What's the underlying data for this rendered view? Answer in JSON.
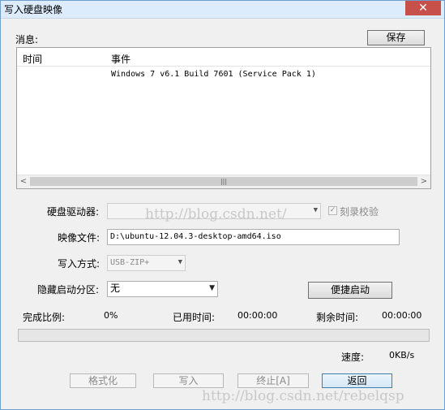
{
  "window": {
    "title": "写入硬盘映像",
    "close_glyph": "✕"
  },
  "messages": {
    "label": "消息:",
    "save_label": "保存",
    "columns": {
      "time": "时间",
      "event": "事件"
    },
    "rows": [
      {
        "time": "",
        "event": "Windows 7 v6.1 Build 7601 (Service Pack 1)"
      }
    ],
    "scroll_left": "<",
    "scroll_right": ">",
    "thumb_grip": "|||"
  },
  "form": {
    "disk_drive_label": "硬盘驱动器:",
    "disk_drive_value": "",
    "verify_label": "刻录校验",
    "verify_checked": true,
    "image_file_label": "映像文件:",
    "image_file_value": "D:\\ubuntu-12.04.3-desktop-amd64.iso",
    "write_method_label": "写入方式:",
    "write_method_value": "USB-ZIP+",
    "hidden_partition_label": "隐藏启动分区:",
    "hidden_partition_value": "无",
    "quick_boot_label": "便捷启动"
  },
  "status": {
    "percent_label": "完成比例:",
    "percent_value": "0%",
    "elapsed_label": "已用时间:",
    "elapsed_value": "00:00:00",
    "remaining_label": "剩余时间:",
    "remaining_value": "00:00:00",
    "progress_fraction": 0,
    "speed_label": "速度:",
    "speed_value": "0KB/s"
  },
  "buttons": {
    "format": "格式化",
    "write": "写入",
    "stop": "终止[A]",
    "back": "返回"
  },
  "watermarks": {
    "center": "http://blog.csdn.net/",
    "bottom": "http://blog.csdn.net/rebelqsp"
  }
}
